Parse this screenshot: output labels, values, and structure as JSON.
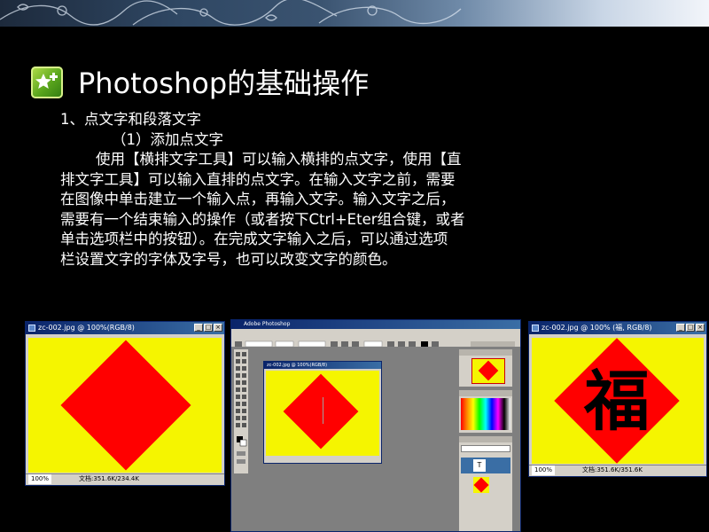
{
  "slide": {
    "title": "Photoshop的基础操作",
    "heading": "1、点文字和段落文字",
    "subheading": "（1）添加点文字",
    "paragraph_lines": [
      "使用【横排文字工具】可以输入横排的点文字，使用【直",
      "排文字工具】可以输入直排的点文字。在输入文字之前，需要",
      "在图像中单击建立一个输入点，再输入文字。输入文字之后，",
      "需要有一个结束输入的操作（或者按下Ctrl+Eter组合键，或者",
      "单击选项栏中的按钮）。在完成文字输入之后，可以通过选项",
      "栏设置文字的字体及字号，也可以改变文字的颜色。"
    ]
  },
  "screens": {
    "left": {
      "title": "zc-002.jpg @ 100%(RGB/8)",
      "zoom": "100%",
      "doc": "文档:351.6K/234.4K"
    },
    "middle": {
      "app_title": "Adobe Photoshop",
      "doc_title": "zc-002.jpg @ 100%(RGB/8)"
    },
    "right": {
      "title": "zc-002.jpg @ 100% (福, RGB/8)",
      "zoom": "100%",
      "doc": "文档:351.6K/351.6K",
      "glyph": "福"
    }
  },
  "colors": {
    "background": "#000000",
    "canvas": "#f5f500",
    "shape": "#ff0000",
    "accent_icon": "#5aa51d"
  }
}
